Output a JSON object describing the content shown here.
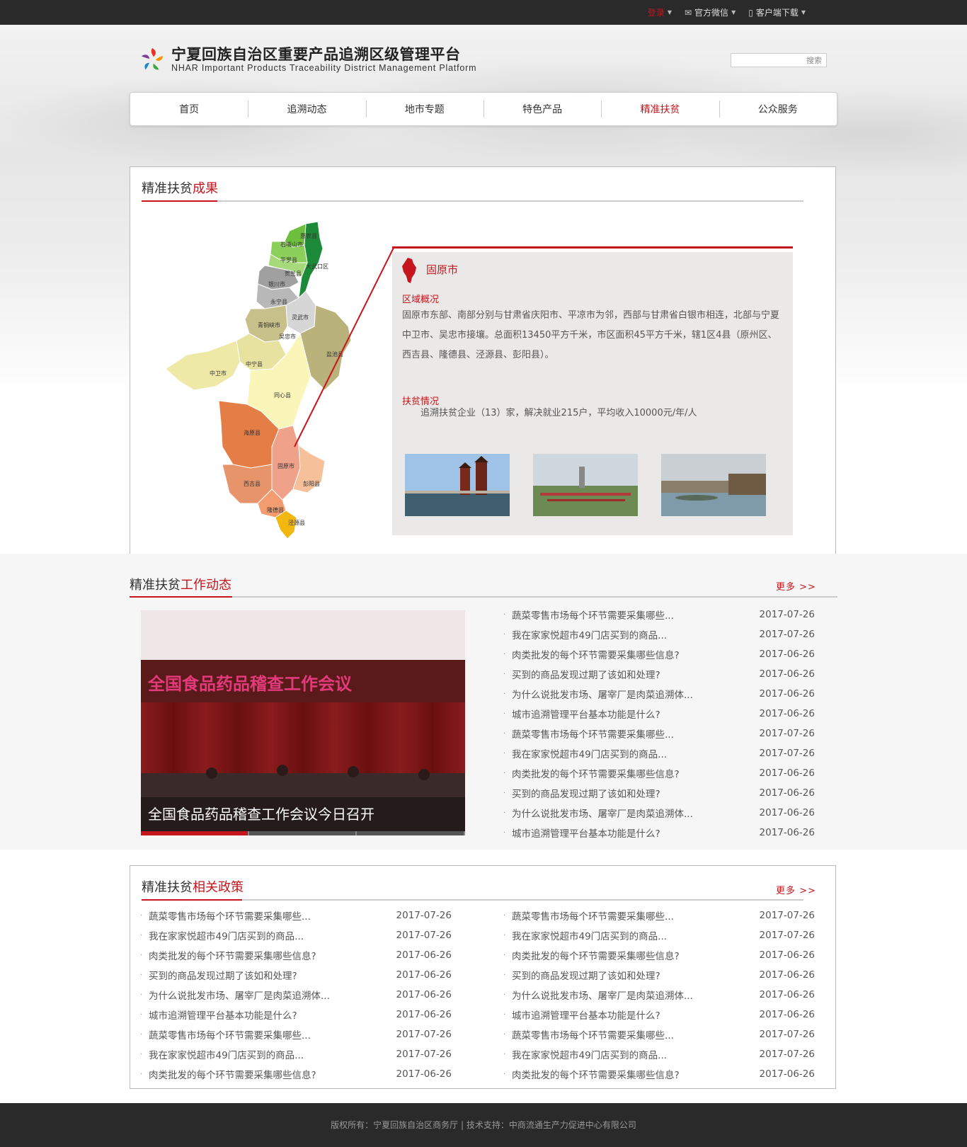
{
  "topbar": {
    "login": "登录",
    "wechat": "官方微信",
    "download": "客户端下载"
  },
  "header": {
    "title_cn": "宁夏回族自治区重要产品追溯区级管理平台",
    "title_en": "NHAR Important Products Traceability District Management Platform",
    "search_button": "搜索"
  },
  "nav": {
    "items": [
      {
        "label": "首页"
      },
      {
        "label": "追溯动态"
      },
      {
        "label": "地市专题"
      },
      {
        "label": "特色产品"
      },
      {
        "label": "精准扶贫"
      },
      {
        "label": "公众服务"
      }
    ],
    "active_index": 4
  },
  "achievements": {
    "title_prefix": "精准扶贫",
    "title_highlight": "成果",
    "map_labels": [
      "惠农县",
      "石嘴山市",
      "平罗县",
      "贺兰县",
      "银川市",
      "永宁县",
      "灵武市",
      "青铜峡市",
      "吴忠市",
      "盐池县",
      "中宁县",
      "中卫市",
      "同心县",
      "海原县",
      "固原市",
      "西吉县",
      "彭阳县",
      "隆德县",
      "泾源县",
      "大武口区"
    ],
    "city": "固原市",
    "overview_title": "区域概况",
    "overview_text": "固原市东部、南部分别与甘肃省庆阳市、平凉市为邻，西部与甘肃省白银市相连，北部与宁夏中卫市、吴忠市接壤。总面积13450平方千米，市区面积45平方千米，辖1区4县（原州区、西吉县、隆德县、泾源县、彭阳县）。",
    "poverty_title": "扶贫情况",
    "poverty_text": "追溯扶贫企业（13）家，解决就业215户，平均收入10000元/年/人"
  },
  "work_news": {
    "title_prefix": "精准扶贫",
    "title_highlight": "工作动态",
    "more": "更多 >>",
    "slide_caption": "全国食品药品稽查工作会议今日召开",
    "banner_text": "全国食品药品稽查工作会议",
    "items": [
      {
        "title": "蔬菜零售市场每个环节需要采集哪些...",
        "date": "2017-07-26"
      },
      {
        "title": "我在家家悦超市49门店买到的商品...",
        "date": "2017-07-26"
      },
      {
        "title": "肉类批发的每个环节需要采集哪些信息?",
        "date": "2017-06-26"
      },
      {
        "title": "买到的商品发现过期了该如和处理?",
        "date": "2017-06-26"
      },
      {
        "title": "为什么说批发市场、屠宰厂是肉菜追溯体...",
        "date": "2017-06-26"
      },
      {
        "title": "城市追溯管理平台基本功能是什么?",
        "date": "2017-06-26"
      },
      {
        "title": "蔬菜零售市场每个环节需要采集哪些...",
        "date": "2017-07-26"
      },
      {
        "title": "我在家家悦超市49门店买到的商品...",
        "date": "2017-07-26"
      },
      {
        "title": "肉类批发的每个环节需要采集哪些信息?",
        "date": "2017-06-26"
      },
      {
        "title": "买到的商品发现过期了该如和处理?",
        "date": "2017-06-26"
      },
      {
        "title": "为什么说批发市场、屠宰厂是肉菜追溯体...",
        "date": "2017-06-26"
      },
      {
        "title": "城市追溯管理平台基本功能是什么?",
        "date": "2017-06-26"
      }
    ]
  },
  "policies": {
    "title_prefix": "精准扶贫",
    "title_highlight": "相关政策",
    "more": "更多 >>",
    "left": [
      {
        "title": "蔬菜零售市场每个环节需要采集哪些...",
        "date": "2017-07-26"
      },
      {
        "title": "我在家家悦超市49门店买到的商品...",
        "date": "2017-07-26"
      },
      {
        "title": "肉类批发的每个环节需要采集哪些信息?",
        "date": "2017-06-26"
      },
      {
        "title": "买到的商品发现过期了该如和处理?",
        "date": "2017-06-26"
      },
      {
        "title": "为什么说批发市场、屠宰厂是肉菜追溯体...",
        "date": "2017-06-26"
      },
      {
        "title": "城市追溯管理平台基本功能是什么?",
        "date": "2017-06-26"
      },
      {
        "title": "蔬菜零售市场每个环节需要采集哪些...",
        "date": "2017-07-26"
      },
      {
        "title": "我在家家悦超市49门店买到的商品...",
        "date": "2017-07-26"
      },
      {
        "title": "肉类批发的每个环节需要采集哪些信息?",
        "date": "2017-06-26"
      }
    ],
    "right": [
      {
        "title": "蔬菜零售市场每个环节需要采集哪些...",
        "date": "2017-07-26"
      },
      {
        "title": "我在家家悦超市49门店买到的商品...",
        "date": "2017-07-26"
      },
      {
        "title": "肉类批发的每个环节需要采集哪些信息?",
        "date": "2017-06-26"
      },
      {
        "title": "买到的商品发现过期了该如和处理?",
        "date": "2017-06-26"
      },
      {
        "title": "为什么说批发市场、屠宰厂是肉菜追溯体...",
        "date": "2017-06-26"
      },
      {
        "title": "城市追溯管理平台基本功能是什么?",
        "date": "2017-06-26"
      },
      {
        "title": "蔬菜零售市场每个环节需要采集哪些...",
        "date": "2017-07-26"
      },
      {
        "title": "我在家家悦超市49门店买到的商品...",
        "date": "2017-07-26"
      },
      {
        "title": "肉类批发的每个环节需要采集哪些信息?",
        "date": "2017-06-26"
      }
    ]
  },
  "footer": {
    "text": "版权所有：宁夏回族自治区商务厅 | 技术支持：中商流通生产力促进中心有限公司"
  },
  "colors": {
    "accent": "#c4161c",
    "topbar": "#2a2a2a",
    "info_bg": "#ebe8e8"
  }
}
